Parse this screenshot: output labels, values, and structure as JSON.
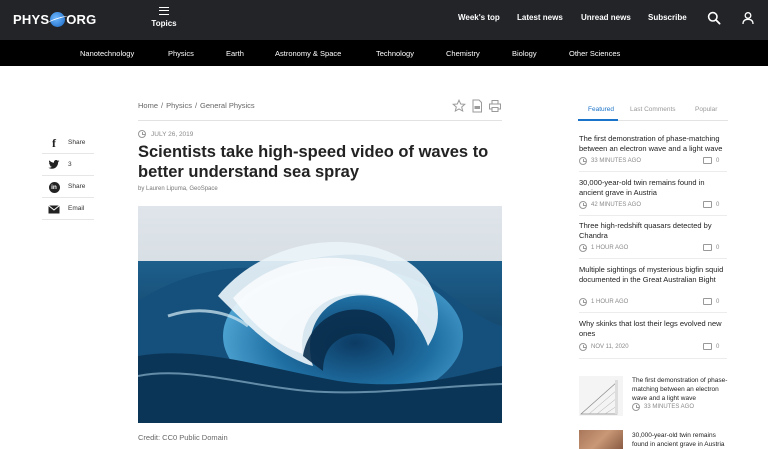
{
  "brand": {
    "part1": "PHYS",
    "part2": "ORG"
  },
  "topbar": {
    "topics_label": "Topics",
    "links": [
      "Week's top",
      "Latest news",
      "Unread news",
      "Subscribe"
    ]
  },
  "categories": [
    "Nanotechnology",
    "Physics",
    "Earth",
    "Astronomy & Space",
    "Technology",
    "Chemistry",
    "Biology",
    "Other Sciences"
  ],
  "breadcrumb": [
    "Home",
    "Physics",
    "General Physics"
  ],
  "article": {
    "date": "JULY 26, 2019",
    "title": "Scientists take high-speed video of waves to better understand sea spray",
    "byline": "by Lauren Lipuma, GeoSpace",
    "credit": "Credit: CC0 Public Domain"
  },
  "share": [
    {
      "icon": "facebook-icon",
      "label": "Share"
    },
    {
      "icon": "twitter-icon",
      "label": "3"
    },
    {
      "icon": "linkedin-icon",
      "label": "Share"
    },
    {
      "icon": "email-icon",
      "label": "Email"
    }
  ],
  "sidebar": {
    "tabs": [
      "Featured",
      "Last Comments",
      "Popular"
    ],
    "active_tab": "Featured",
    "stories": [
      {
        "title": "The first demonstration of phase-matching between an electron wave and a light wave",
        "time": "33 MINUTES AGO",
        "comments": "0"
      },
      {
        "title": "30,000-year-old twin remains found in ancient grave in Austria",
        "time": "42 MINUTES AGO",
        "comments": "0"
      },
      {
        "title": "Three high-redshift quasars detected by Chandra",
        "time": "1 HOUR AGO",
        "comments": "0"
      },
      {
        "title": "Multiple sightings of mysterious bigfin squid documented in the Great Australian Bight",
        "time": "1 HOUR AGO",
        "comments": "0"
      },
      {
        "title": "Why skinks that lost their legs evolved new ones",
        "time": "NOV 11, 2020",
        "comments": "0"
      }
    ],
    "thumb_stories": [
      {
        "title": "The first demonstration of phase-matching between an electron wave and a light wave",
        "time": "33 MINUTES AGO"
      },
      {
        "title": "30,000-year-old twin remains found in ancient grave in Austria",
        "time": ""
      }
    ]
  },
  "colors": {
    "topbar": "#222428",
    "catbar": "#000000",
    "accent": "#1a73c9"
  }
}
